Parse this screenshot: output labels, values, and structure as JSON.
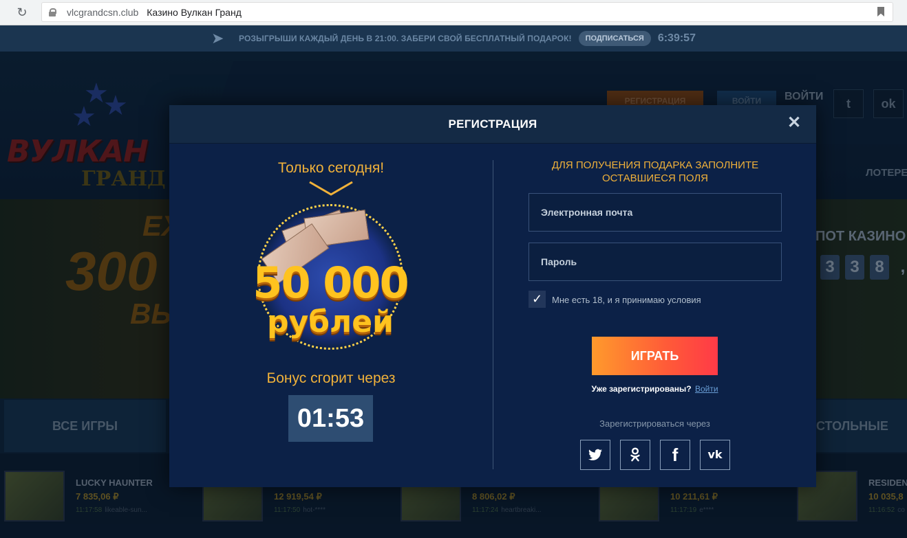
{
  "browser": {
    "domain": "vlcgrandcsn.club",
    "tab_title": "Казино Вулкан Гранд"
  },
  "promo": {
    "text": "РОЗЫГРЫШИ КАЖДЫЙ ДЕНЬ В 21:00. ЗАБЕРИ СВОЙ БЕСПЛАТНЫЙ ПОДАРОК!",
    "subscribe_label": "ПОДПИСАТЬСЯ",
    "timer": "6:39:57"
  },
  "site": {
    "logo_word1": "ВУЛКАН",
    "logo_word2": "ГРАНД",
    "register_label": "РЕГИСТРАЦИЯ",
    "login_button_label": "ВОЙТИ",
    "login_text": "ВОЙТИ",
    "lottery_label": "ЛОТЕРЕ",
    "jackpot_title": "ПОТ КАЗИНО",
    "jackpot_digits": [
      "3",
      "3",
      "8",
      ","
    ],
    "tab_all_games": "ВСЕ ИГРЫ",
    "tab_table": "СТОЛЬНЫЕ",
    "banner_line1": "ЕХ",
    "banner_line2": "300",
    "banner_line3": "ВЫ",
    "wins": [
      {
        "name": "LUCKY HAUNTER",
        "amount": "7 835,06 ₽",
        "time": "11:17:58",
        "user": "likeable-sun..."
      },
      {
        "name": "",
        "amount": "12 919,54 ₽",
        "time": "11:17:50",
        "user": "hot-****"
      },
      {
        "name": "",
        "amount": "8 806,02 ₽",
        "time": "11:17:24",
        "user": "heartbreaki..."
      },
      {
        "name": "",
        "amount": "10 211,61 ₽",
        "time": "11:17:19",
        "user": "e****"
      },
      {
        "name": "RESIDEN",
        "amount": "10 035,8",
        "time": "11:16:52",
        "user": "co"
      }
    ]
  },
  "modal": {
    "title": "РЕГИСТРАЦИЯ",
    "close_symbol": "✕",
    "today_text": "Только сегодня!",
    "prize_amount": "50 000",
    "prize_unit": "рублей",
    "bonus_burns_text": "Бонус сгорит через",
    "countdown": "01:53",
    "form_title": "ДЛЯ ПОЛУЧЕНИЯ ПОДАРКА ЗАПОЛНИТЕ ОСТАВШИЕСЯ ПОЛЯ",
    "email_placeholder": "Электронная почта",
    "password_placeholder": "Пароль",
    "age_checked": true,
    "age_label": "Мне есть 18, и я принимаю условия",
    "play_label": "ИГРАТЬ",
    "already_registered": "Уже зарегистрированы?",
    "login_link": "Войти",
    "register_via": "Зарегистрироваться через",
    "social": [
      {
        "icon": "twitter-icon",
        "glyph": "🐦"
      },
      {
        "icon": "odnoklassniki-icon",
        "glyph": "ok"
      },
      {
        "icon": "facebook-icon",
        "glyph": "f"
      },
      {
        "icon": "vk-icon",
        "glyph": "vk"
      }
    ]
  }
}
